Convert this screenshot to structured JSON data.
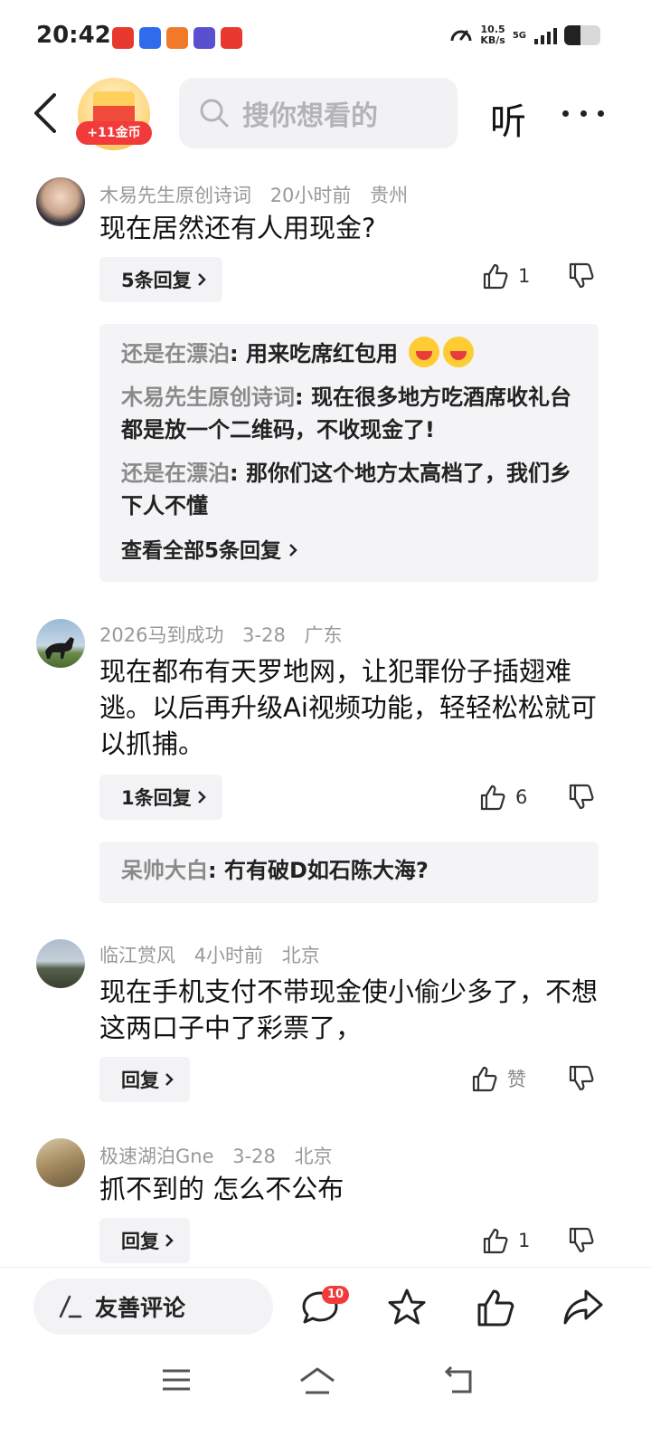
{
  "status_bar": {
    "time": "20:42",
    "speed_value": "10.5",
    "speed_unit": "KB/s",
    "network": "5G",
    "battery_level": 0.45,
    "app_icons": [
      "toutiao-icon",
      "baidu-icon",
      "game-icon",
      "game2-icon",
      "toutiao-lite-icon"
    ]
  },
  "header": {
    "coin_badge": "+11金币",
    "search_placeholder": "搜你想看的",
    "listen_label": "听"
  },
  "comments": [
    {
      "user": "木易先生原创诗词",
      "time": "20小时前",
      "location": "贵州",
      "text": "现在居然还有人用现金?",
      "reply_label": "5条回复",
      "likes": "1",
      "replies": [
        {
          "who": "还是在漂泊",
          "text": "用来吃席红包用"
        },
        {
          "who": "木易先生原创诗词",
          "text": "现在很多地方吃酒席收礼台都是放一个二维码，不收现金了!"
        },
        {
          "who": "还是在漂泊",
          "text": "那你们这个地方太高档了，我们乡下人不懂"
        }
      ],
      "see_all": "查看全部5条回复"
    },
    {
      "user": "2026马到成功",
      "time": "3-28",
      "location": "广东",
      "text": "现在都布有天罗地网，让犯罪份子插翅难逃。以后再升级Ai视频功能，轻轻松松就可以抓捕。",
      "reply_label": "1条回复",
      "likes": "6",
      "replies": [
        {
          "who": "呆帅大白",
          "text": "冇有破D如石陈大海?"
        }
      ]
    },
    {
      "user": "临江赏风",
      "time": "4小时前",
      "location": "北京",
      "text": "现在手机支付不带现金使小偷少多了，不想这两口子中了彩票了，",
      "reply_label": "回复",
      "likes": "赞"
    },
    {
      "user": "极速湖泊Gne",
      "time": "3-28",
      "location": "北京",
      "text": "抓不到的 怎么不公布",
      "reply_label": "回复",
      "likes": "1"
    }
  ],
  "bottom_bar": {
    "input_label": "友善评论",
    "comment_count": "10"
  },
  "colors": {
    "accent_red": "#f23a3a",
    "muted_text": "#999999",
    "panel_bg": "#f4f4f6"
  }
}
